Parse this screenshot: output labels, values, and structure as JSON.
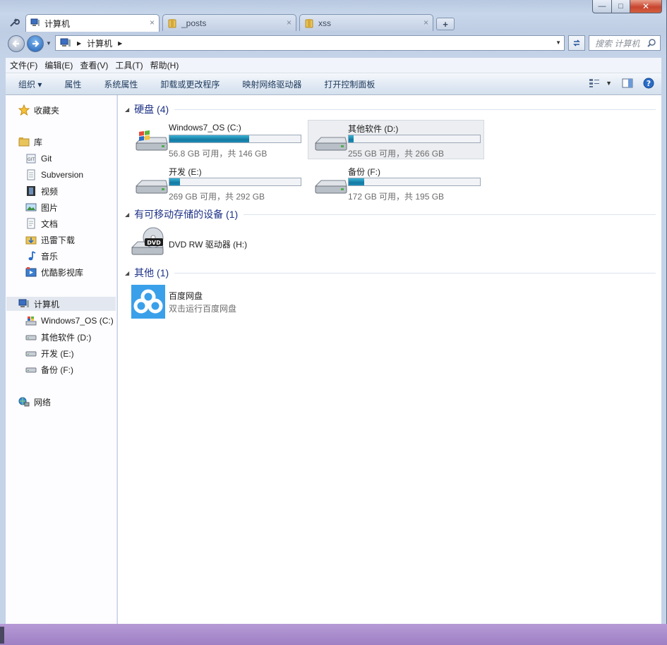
{
  "window": {
    "controls": {
      "minimize": "—",
      "maximize": "□",
      "close": "✕"
    }
  },
  "tabs": [
    {
      "label": "计算机",
      "icon": "computer-icon",
      "active": true
    },
    {
      "label": "_posts",
      "icon": "folder-icon",
      "active": false
    },
    {
      "label": "xss",
      "icon": "folder-icon",
      "active": false
    }
  ],
  "tab_close": "×",
  "tab_new": "+",
  "address": {
    "crumb": "计算机"
  },
  "search": {
    "placeholder": "搜索 计算机"
  },
  "menu": [
    "文件(F)",
    "编辑(E)",
    "查看(V)",
    "工具(T)",
    "帮助(H)"
  ],
  "commands": [
    "组织 ▾",
    "属性",
    "系统属性",
    "卸载或更改程序",
    "映射网络驱动器",
    "打开控制面板"
  ],
  "nav": {
    "favorites": "收藏夹",
    "libraries": "库",
    "library_items": [
      "Git",
      "Subversion",
      "视频",
      "图片",
      "文档",
      "迅雷下载",
      "音乐",
      "优酷影视库"
    ],
    "computer": "计算机",
    "computer_items": [
      "Windows7_OS (C:)",
      "其他软件 (D:)",
      "开发 (E:)",
      "备份 (F:)"
    ],
    "network": "网络"
  },
  "groups": {
    "hard_disks": "硬盘 (4)",
    "removable": "有可移动存储的设备 (1)",
    "other": "其他 (1)"
  },
  "drives": [
    {
      "name": "Windows7_OS (C:)",
      "free": "56.8 GB 可用，共 146 GB",
      "used_fraction": 0.61
    },
    {
      "name": "其他软件 (D:)",
      "free": "255 GB 可用，共 266 GB",
      "used_fraction": 0.04
    },
    {
      "name": "开发 (E:)",
      "free": "269 GB 可用，共 292 GB",
      "used_fraction": 0.08
    },
    {
      "name": "备份 (F:)",
      "free": "172 GB 可用，共 195 GB",
      "used_fraction": 0.12
    }
  ],
  "dvd": {
    "name": "DVD RW 驱动器 (H:)",
    "badge": "DVD"
  },
  "baidu": {
    "name": "百度网盘",
    "desc": "双击运行百度网盘"
  },
  "colors": {
    "accent": "#1e3287",
    "bar_fill": "#1c8bb6",
    "baidu": "#3aa0ea"
  }
}
